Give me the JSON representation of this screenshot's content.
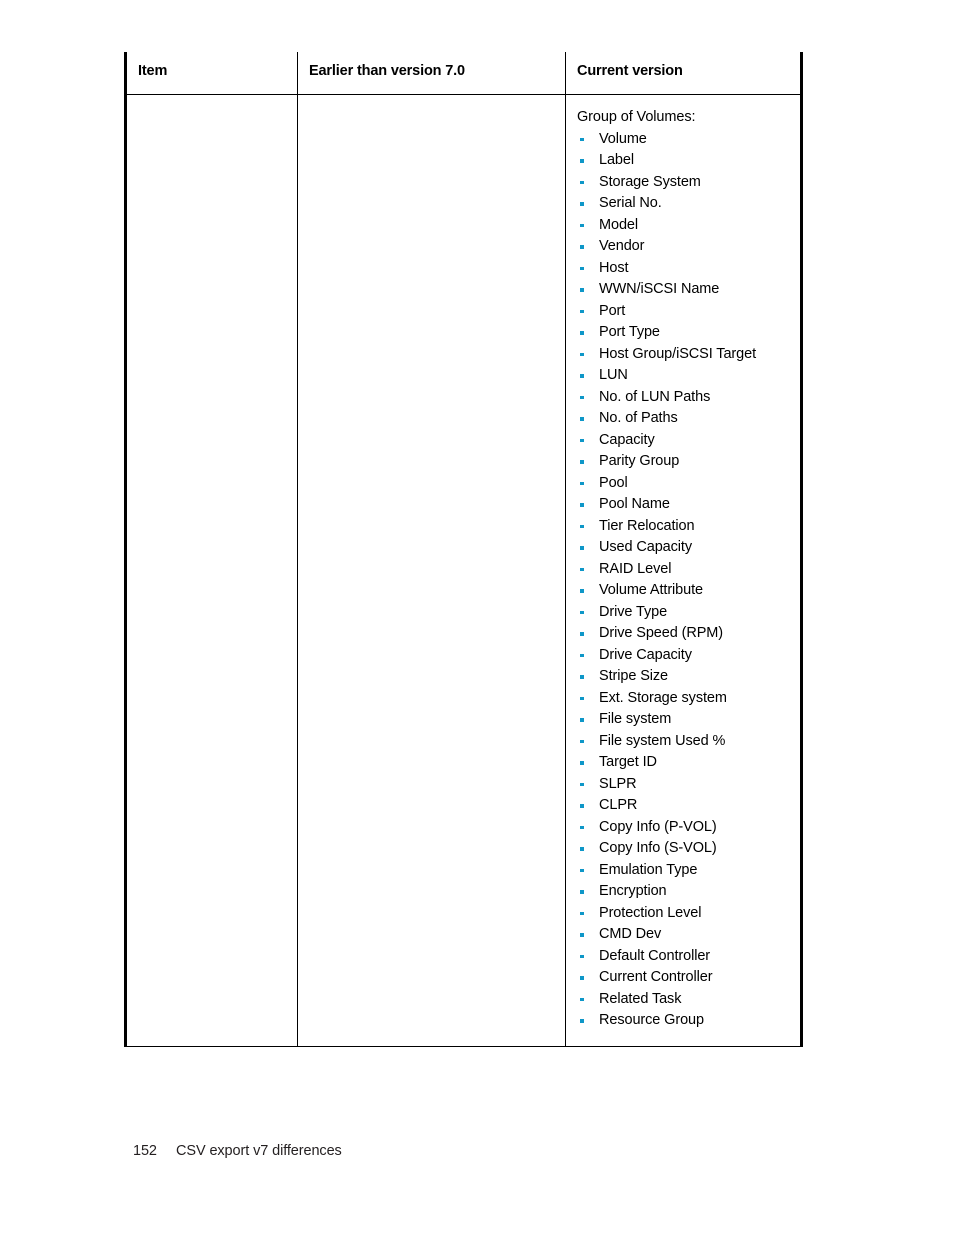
{
  "document": {
    "table": {
      "columns": [
        {
          "id": "item",
          "header": "Item"
        },
        {
          "id": "earlier",
          "header": "Earlier than version 7.0"
        },
        {
          "id": "current",
          "header": "Current version"
        }
      ],
      "rows": [
        {
          "item": "",
          "earlier": "",
          "current_lead": "Group of Volumes:",
          "current_bullets": [
            "Volume",
            "Label",
            "Storage System",
            "Serial No.",
            "Model",
            "Vendor",
            "Host",
            "WWN/iSCSI Name",
            "Port",
            "Port Type",
            "Host Group/iSCSI Target",
            "LUN",
            "No. of LUN Paths",
            "No. of Paths",
            "Capacity",
            "Parity Group",
            "Pool",
            "Pool Name",
            "Tier Relocation",
            "Used Capacity",
            "RAID Level",
            "Volume Attribute",
            "Drive Type",
            "Drive Speed (RPM)",
            "Drive Capacity",
            "Stripe Size",
            "Ext. Storage system",
            "File system",
            "File system Used %",
            "Target ID",
            "SLPR",
            "CLPR",
            "Copy Info (P-VOL)",
            "Copy Info (S-VOL)",
            "Emulation Type",
            "Encryption",
            "Protection Level",
            "CMD Dev",
            "Default Controller",
            "Current Controller",
            "Related Task",
            "Resource Group"
          ]
        }
      ]
    },
    "footer": {
      "page_number": "152",
      "section_title": "CSV export v7 differences"
    },
    "colors": {
      "bullet": "#0e97c8",
      "rule": "#000000",
      "text": "#000000",
      "footer_text": "#231f20"
    }
  }
}
